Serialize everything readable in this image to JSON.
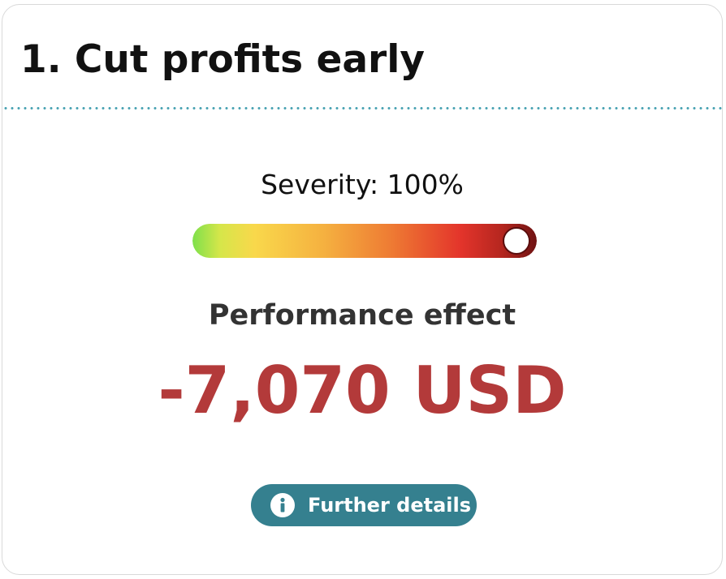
{
  "card": {
    "title": "1. Cut profits early"
  },
  "severity": {
    "label": "Severity: 100%",
    "level_percent": 100,
    "gradient_colors": [
      "#7ee04b",
      "#f9d84b",
      "#f5b140",
      "#ee7a33",
      "#e3342b",
      "#6f1212"
    ]
  },
  "performance": {
    "label": "Performance effect",
    "value": "-7,070 USD",
    "value_color": "#b33a3a"
  },
  "details_button": {
    "label": "Further details",
    "icon": "info-icon",
    "background_color": "#35808f"
  },
  "colors": {
    "divider": "#4aa3b3"
  }
}
